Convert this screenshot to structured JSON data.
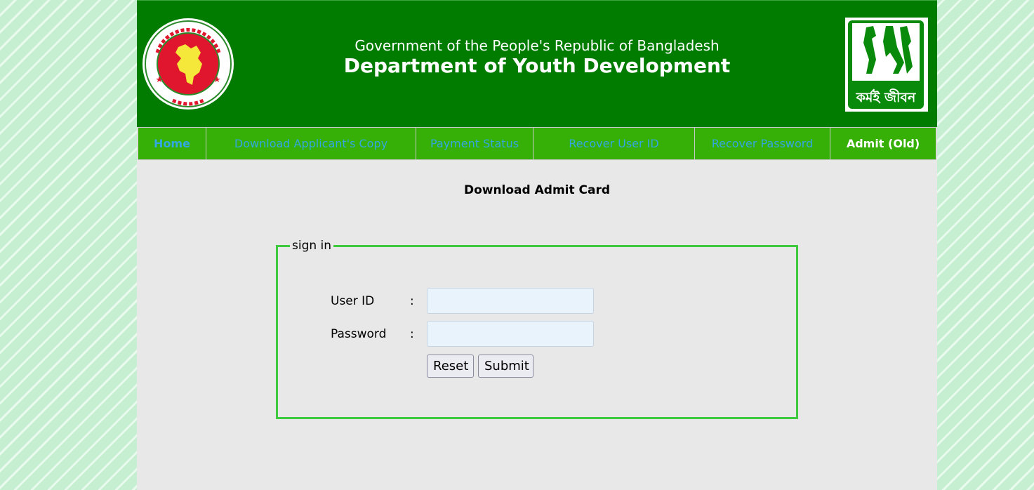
{
  "header": {
    "government": "Government of the People's Republic of Bangladesh",
    "department": "Department of Youth Development",
    "right_logo_caption": "কর্মই জীবন"
  },
  "nav": [
    {
      "label": "Home"
    },
    {
      "label": "Download Applicant's Copy"
    },
    {
      "label": "Payment Status"
    },
    {
      "label": "Recover User ID"
    },
    {
      "label": "Recover Password"
    },
    {
      "label": "Admit (Old)"
    }
  ],
  "main": {
    "title": "Download Admit Card",
    "signin": {
      "legend": "sign in",
      "user_id_label": "User ID",
      "password_label": "Password",
      "colon": ":",
      "user_id_value": "",
      "password_value": "",
      "reset_label": "Reset",
      "submit_label": "Submit"
    }
  },
  "colors": {
    "header_bg": "#017c01",
    "nav_bg": "#36b006",
    "nav_text": "#33a7e0",
    "fieldset_border": "#3ec93e",
    "seal_red": "#e0152e",
    "map_yellow": "#f6e83b"
  }
}
